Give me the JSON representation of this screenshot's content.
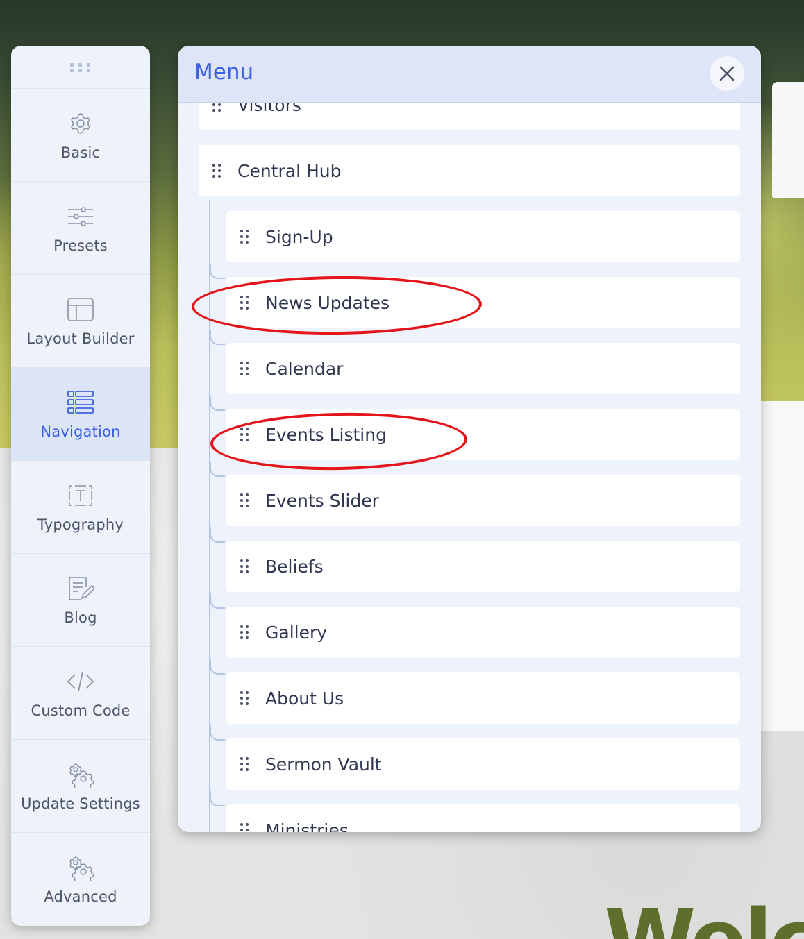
{
  "sidebar": {
    "handle_icon": "grip-dots-icon",
    "items": [
      {
        "label": "Basic",
        "icon": "gear-icon"
      },
      {
        "label": "Presets",
        "icon": "sliders-icon"
      },
      {
        "label": "Layout Builder",
        "icon": "layout-icon"
      },
      {
        "label": "Navigation",
        "icon": "list-icon",
        "active": true
      },
      {
        "label": "Typography",
        "icon": "text-box-icon"
      },
      {
        "label": "Blog",
        "icon": "edit-document-icon"
      },
      {
        "label": "Custom Code",
        "icon": "code-icon"
      },
      {
        "label": "Update Settings",
        "icon": "gears-icon"
      },
      {
        "label": "Advanced",
        "icon": "gears-icon"
      }
    ]
  },
  "panel": {
    "title": "Menu",
    "close_icon": "close-icon",
    "items": [
      {
        "label": "Visitors",
        "level": 0
      },
      {
        "label": "Central Hub",
        "level": 0
      },
      {
        "label": "Sign-Up",
        "level": 1
      },
      {
        "label": "News Updates",
        "level": 1,
        "circled": true
      },
      {
        "label": "Calendar",
        "level": 1
      },
      {
        "label": "Events Listing",
        "level": 1,
        "circled": true
      },
      {
        "label": "Events Slider",
        "level": 1
      },
      {
        "label": "Beliefs",
        "level": 1
      },
      {
        "label": "Gallery",
        "level": 1
      },
      {
        "label": "About Us",
        "level": 1
      },
      {
        "label": "Sermon Vault",
        "level": 1
      },
      {
        "label": "Ministries",
        "level": 1
      }
    ]
  },
  "annotation_color": "#e4141b",
  "accent_color": "#3e63e2",
  "background_headline": "Welc"
}
